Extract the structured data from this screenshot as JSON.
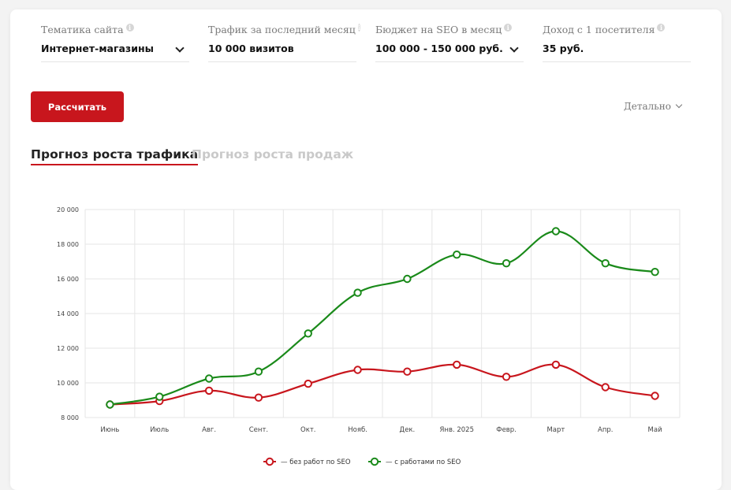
{
  "form": {
    "fields": [
      {
        "label": "Тематика сайта",
        "value": "Интернет-магазины",
        "dropdown": true
      },
      {
        "label": "Трафик за последний месяц",
        "value": "10 000 визитов",
        "dropdown": false
      },
      {
        "label": "Бюджет на SEO в месяц",
        "value": "100 000 - 150 000 руб.",
        "dropdown": true
      },
      {
        "label": "Доход с 1 посетителя",
        "value": "35 руб.",
        "dropdown": false
      }
    ],
    "calc_button": "Рассчитать",
    "detail_link": "Детально"
  },
  "tabs": [
    {
      "label": "Прогноз роста трафика",
      "active": true
    },
    {
      "label": "Прогноз роста продаж",
      "active": false
    }
  ],
  "colors": {
    "accent": "#c8161d",
    "series_red": "#c8161d",
    "series_green": "#1a8a1a"
  },
  "chart_data": {
    "type": "line",
    "categories": [
      "Июнь",
      "Июль",
      "Авг.",
      "Сент.",
      "Окт.",
      "Нояб.",
      "Дек.",
      "Янв. 2025",
      "Февр.",
      "Март",
      "Апр.",
      "Май"
    ],
    "ylim": [
      8000,
      20000
    ],
    "yticks": [
      8000,
      10000,
      12000,
      14000,
      16000,
      18000,
      20000
    ],
    "ytick_labels": [
      "8 000",
      "10 000",
      "12 000",
      "14 000",
      "16 000",
      "18 000",
      "20 000"
    ],
    "grid": true,
    "legend_position": "bottom-center",
    "series": [
      {
        "name": "— без работ по SEO",
        "color": "#c8161d",
        "values": [
          8750,
          8950,
          9550,
          9150,
          9950,
          10750,
          10650,
          11050,
          10350,
          11050,
          9750,
          9250
        ]
      },
      {
        "name": "— с работами по SEO",
        "color": "#1a8a1a",
        "values": [
          8750,
          9200,
          10250,
          10650,
          12850,
          15200,
          16000,
          17400,
          16900,
          18750,
          16900,
          16400
        ]
      }
    ]
  }
}
